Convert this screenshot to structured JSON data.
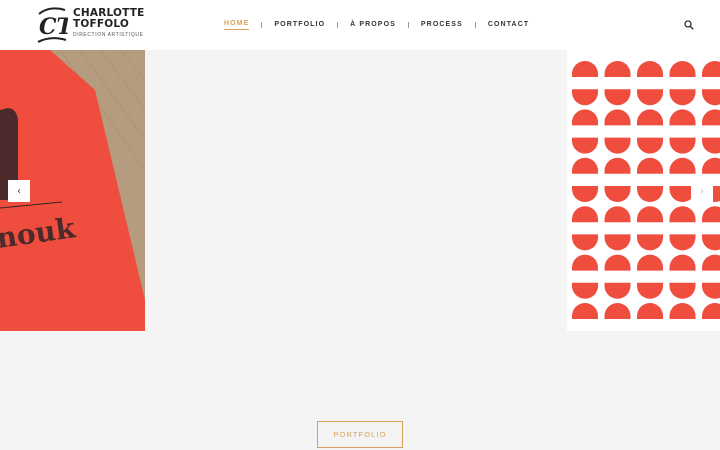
{
  "brand": {
    "name": "CHARLOTTE TOFFOLO",
    "tagline": "DIRECTION ARTISTIQUE",
    "monogram": "CT"
  },
  "nav": {
    "items": [
      {
        "label": "HOME",
        "active": true
      },
      {
        "label": "PORTFOLIO",
        "active": false
      },
      {
        "label": "À PROPOS",
        "active": false
      },
      {
        "label": "PROCESS",
        "active": false
      },
      {
        "label": "CONTACT",
        "active": false
      }
    ],
    "search_icon": "search-icon"
  },
  "slider": {
    "prev_arrow": "‹",
    "next_arrow": "›",
    "left_slide_text": "nouk"
  },
  "cta": {
    "label": "PORTFOLIO"
  },
  "colors": {
    "accent": "#d9a05b",
    "poster_red": "#ef4d3d",
    "background": "#f4f4f4"
  }
}
